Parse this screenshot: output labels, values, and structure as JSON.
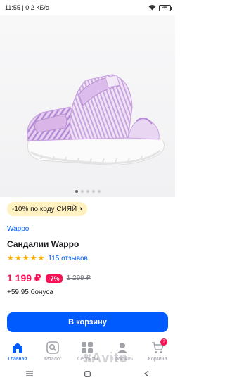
{
  "status_bar": {
    "time_speed": "11:55 | 0,2 КБ/с",
    "battery": "44"
  },
  "product_image": {
    "subject": "lavender-white children's sandal",
    "colors": {
      "sandal_pink": "#d9b5e8",
      "sandal_stripe": "#b48ad6",
      "sole": "#f7f7f7"
    },
    "slides_total": 5,
    "slide_active": 1
  },
  "promo": {
    "text": "-10% по коду СИЯЙ",
    "chevron": "›"
  },
  "product": {
    "brand": "Wappo",
    "title": "Сандалии Wappo",
    "rating_stars": 5,
    "reviews": "115 отзывов",
    "price": "1 199 ₽",
    "discount": "-7%",
    "old_price": "1 299 ₽",
    "bonus": "+59,95 бонуса"
  },
  "cart_button": {
    "label": "В корзину"
  },
  "tabbar": {
    "items": [
      {
        "label": "Главная",
        "icon": "home-icon",
        "active": true
      },
      {
        "label": "Каталог",
        "icon": "catalog-search-icon",
        "active": false
      },
      {
        "label": "Сервисы",
        "icon": "services-grid-icon",
        "active": false
      },
      {
        "label": "Профиль",
        "icon": "profile-icon",
        "active": false
      },
      {
        "label": "Корзина",
        "icon": "cart-icon",
        "active": false,
        "badge": "7"
      }
    ]
  },
  "watermark": "Avito",
  "colors": {
    "accent_blue": "#005bff",
    "price_red": "#f91155",
    "promo_bg": "#fff2c0",
    "star": "#ffa800"
  }
}
